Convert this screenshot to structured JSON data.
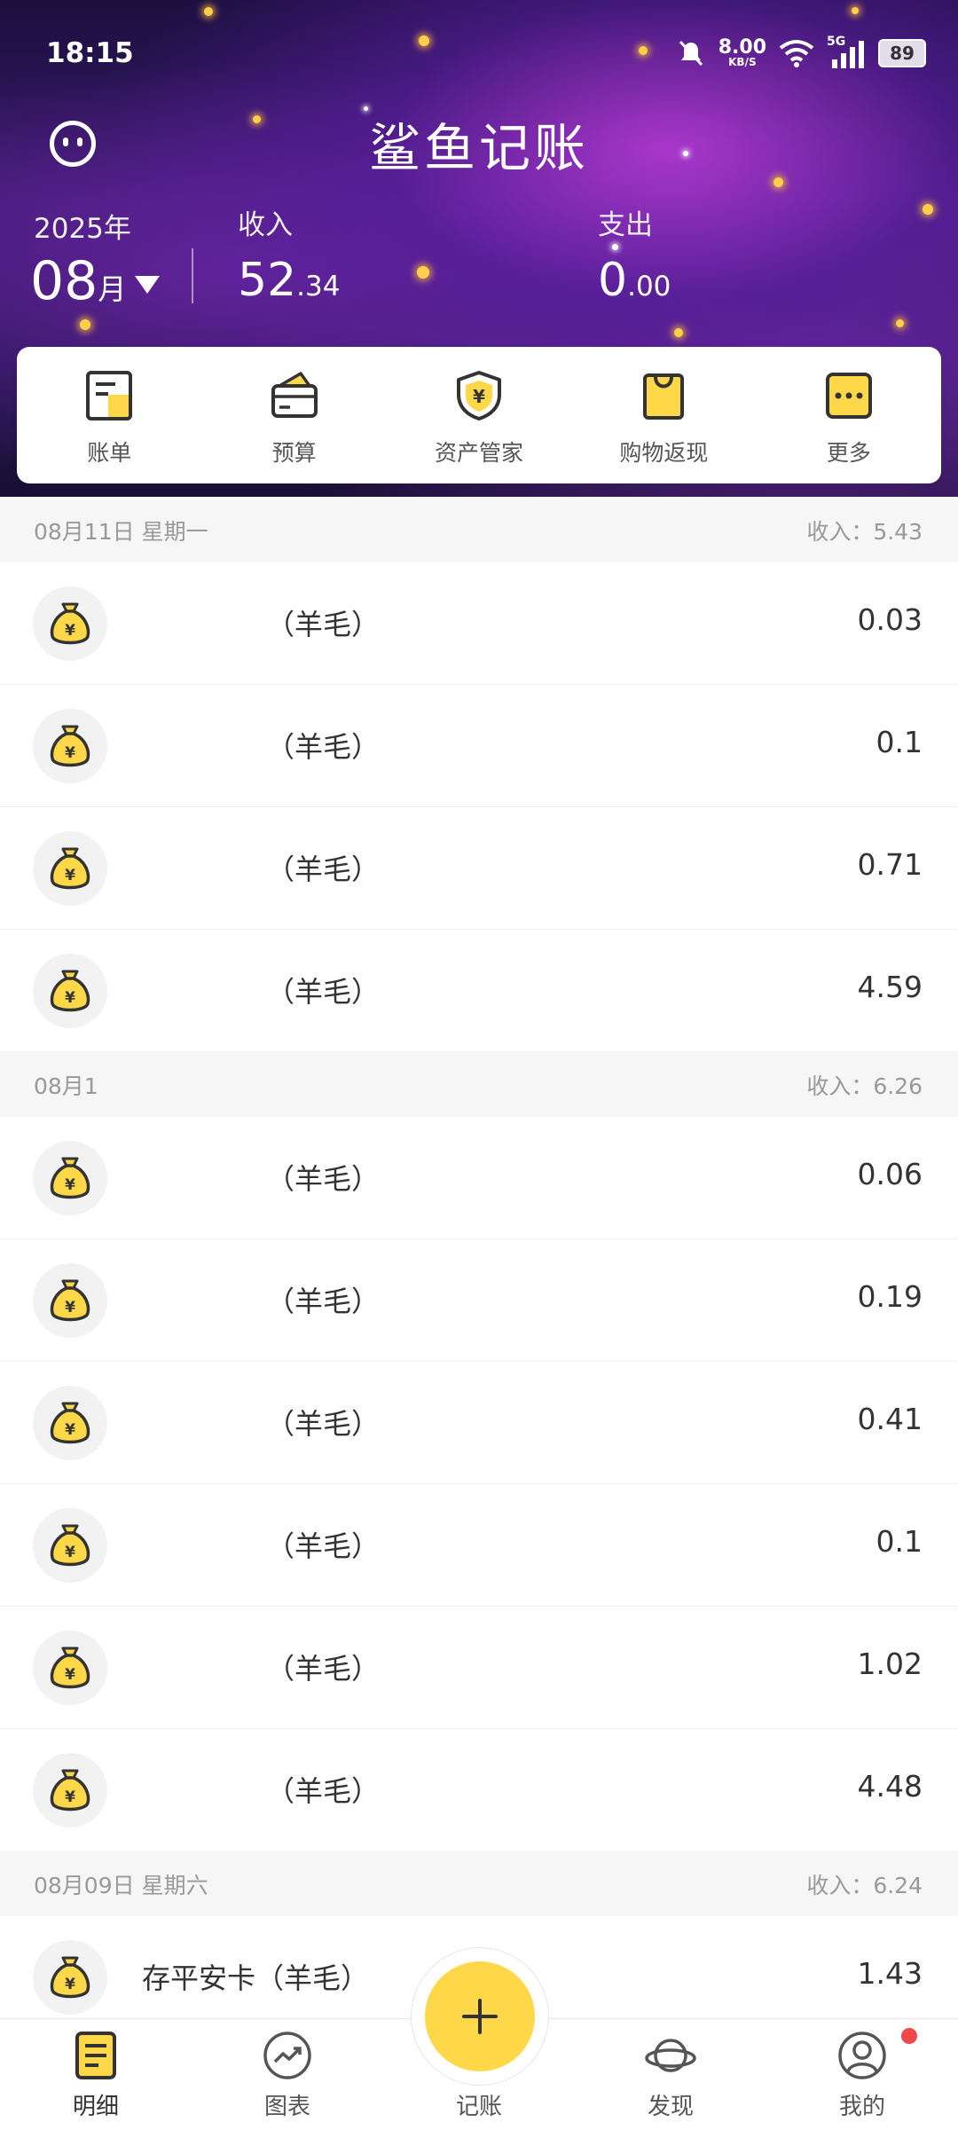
{
  "status_bar": {
    "time": "18:15",
    "net_speed": "8.00",
    "net_unit": "KB/S",
    "signal": "5G",
    "battery": "89"
  },
  "header": {
    "title": "鲨鱼记账",
    "year": "2025年",
    "month": "08",
    "month_unit": "月",
    "income_label": "收入",
    "income_int": "52",
    "income_dec": ".34",
    "expense_label": "支出",
    "expense_int": "0",
    "expense_dec": ".00"
  },
  "quick_menu": [
    {
      "label": "账单",
      "icon": "bill-icon"
    },
    {
      "label": "预算",
      "icon": "budget-wallet-icon"
    },
    {
      "label": "资产管家",
      "icon": "asset-shield-icon"
    },
    {
      "label": "购物返现",
      "icon": "shopping-bag-icon"
    },
    {
      "label": "更多",
      "icon": "more-dots-icon"
    }
  ],
  "groups": [
    {
      "date": "08月11日 星期一",
      "income": "收入：5.43",
      "rows": [
        {
          "name": "（羊毛）",
          "amount": "0.03"
        },
        {
          "name": "（羊毛）",
          "amount": "0.1"
        },
        {
          "name": "（羊毛）",
          "amount": "0.71"
        },
        {
          "name": "（羊毛）",
          "amount": "4.59"
        }
      ]
    },
    {
      "date": "08月1",
      "income": "收入：6.26",
      "rows": [
        {
          "name": "（羊毛）",
          "amount": "0.06"
        },
        {
          "name": "（羊毛）",
          "amount": "0.19"
        },
        {
          "name": "（羊毛）",
          "amount": "0.41"
        },
        {
          "name": "（羊毛）",
          "amount": "0.1"
        },
        {
          "name": "（羊毛）",
          "amount": "1.02"
        },
        {
          "name": "（羊毛）",
          "amount": "4.48"
        }
      ]
    },
    {
      "date": "08月09日 星期六",
      "income": "收入：6.24",
      "rows": [
        {
          "name": "存平安卡（羊毛）",
          "amount": "1.43"
        }
      ]
    }
  ],
  "bottom_nav": [
    {
      "label": "明细",
      "icon": "detail-list-icon"
    },
    {
      "label": "图表",
      "icon": "chart-trend-icon"
    },
    {
      "label": "记账",
      "icon": "add-record-icon"
    },
    {
      "label": "发现",
      "icon": "planet-discover-icon"
    },
    {
      "label": "我的",
      "icon": "profile-icon"
    }
  ],
  "colors": {
    "accent": "#ffd84a",
    "badge": "#f04848"
  }
}
